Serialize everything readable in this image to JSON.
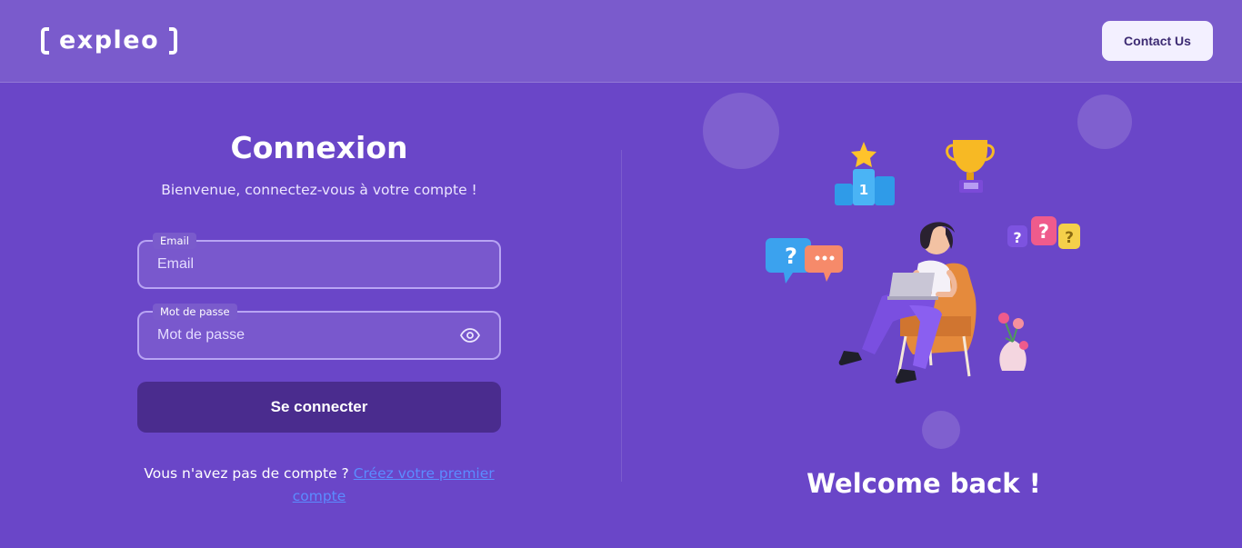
{
  "header": {
    "logo_text": "expleo",
    "contact_label": "Contact Us"
  },
  "login": {
    "title": "Connexion",
    "subtitle": "Bienvenue, connectez-vous à votre compte !",
    "email": {
      "label": "Email",
      "placeholder": "Email",
      "value": ""
    },
    "password": {
      "label": "Mot de passe",
      "placeholder": "Mot de passe",
      "value": "",
      "toggle_icon": "eye-icon"
    },
    "submit_label": "Se connecter",
    "signup_prompt": "Vous n'avez pas de compte ?",
    "signup_link": "Créez votre premier compte"
  },
  "hero": {
    "welcome_text": "Welcome back !",
    "illustration": "woman-with-laptop-on-chair",
    "decorations": [
      "podium-star-icon",
      "trophy-icon",
      "question-chat-bubbles-icon",
      "question-blocks-icon",
      "flower-vase-icon"
    ]
  },
  "colors": {
    "background": "#6a46c8",
    "header": "#7a5bcc",
    "button_dark": "#4a2c8e",
    "link": "#5b8cff"
  }
}
